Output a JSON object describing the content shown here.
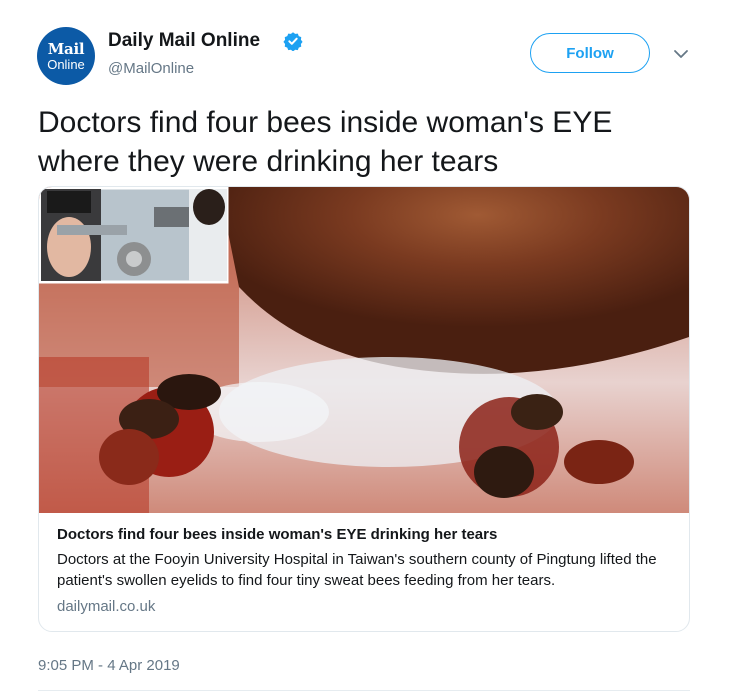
{
  "author": {
    "avatar_line1": "Mail",
    "avatar_line2": "Online",
    "display_name": "Daily Mail Online",
    "handle": "@MailOnline",
    "verified": true
  },
  "follow_label": "Follow",
  "tweet_text": "Doctors find four bees inside woman's EYE where they were drinking her tears",
  "card": {
    "title": "Doctors find four bees inside woman's EYE drinking her tears",
    "description": "Doctors at the Fooyin University Hospital in Taiwan's southern county of Pingtung lifted the patient's swollen eyelids to find four tiny sweat bees feeding from her tears.",
    "domain": "dailymail.co.uk"
  },
  "timestamp": "9:05 PM - 4 Apr 2019",
  "colors": {
    "accent": "#1da1f2",
    "secondary_text": "#657786",
    "avatar_bg": "#0c5aa6",
    "verified": "#1da1f2"
  }
}
